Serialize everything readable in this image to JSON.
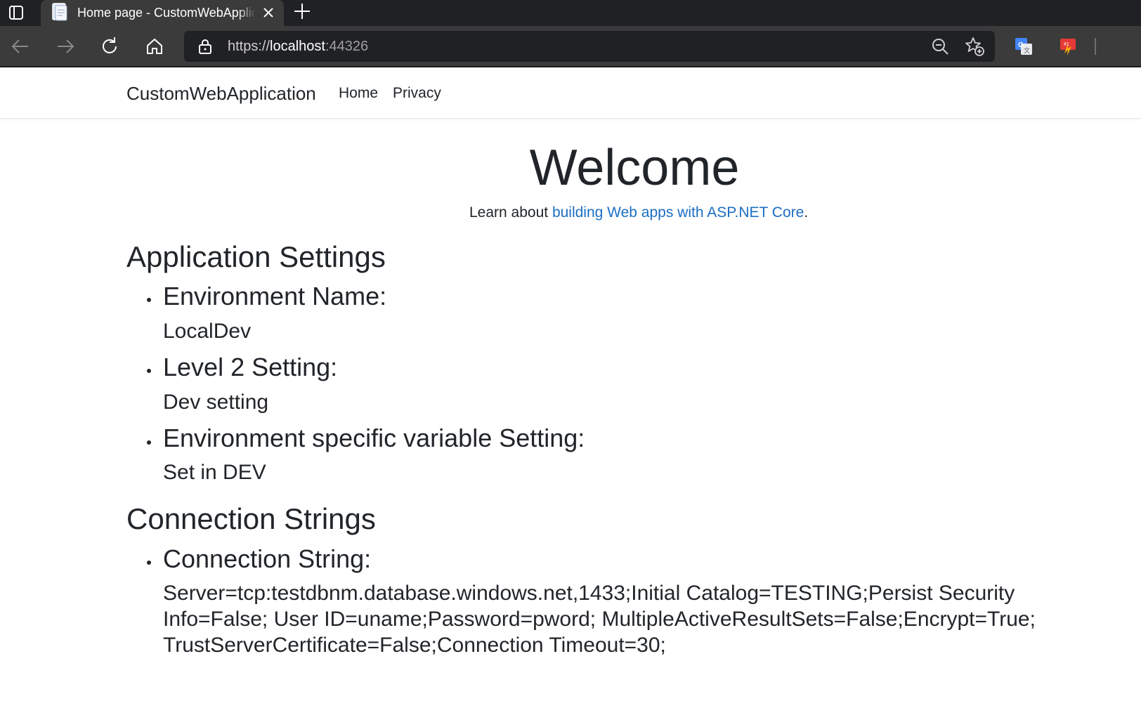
{
  "browser": {
    "tab": {
      "title": "Home page - CustomWebApplication"
    },
    "address": {
      "scheme": "https://",
      "host": "localhost",
      "port": ":44326"
    },
    "icons": {
      "tab_actions": "tab-actions-icon",
      "favicon": "page-icon",
      "close_tab": "close-icon",
      "new_tab": "plus-icon",
      "back": "back-arrow-icon",
      "forward": "forward-arrow-icon",
      "refresh": "refresh-icon",
      "home": "home-icon",
      "lock": "lock-icon",
      "zoom": "zoom-out-icon",
      "favorite": "add-favorite-icon",
      "translate": "translate-icon",
      "extension": "extension-icon"
    },
    "colors": {
      "tabstrip": "#202124",
      "toolbar": "#3b3b3b",
      "link": "#1b6ec2"
    }
  },
  "navbar": {
    "brand": "CustomWebApplication",
    "links": [
      "Home",
      "Privacy"
    ]
  },
  "main": {
    "title": "Welcome",
    "learn_prefix": "Learn about ",
    "learn_link": "building Web apps with ASP.NET Core",
    "learn_suffix": ".",
    "app_settings": {
      "heading": "Application Settings",
      "items": [
        {
          "label": "Environment Name:",
          "value": "LocalDev"
        },
        {
          "label": "Level 2 Setting:",
          "value": "Dev setting"
        },
        {
          "label": "Environment specific variable Setting:",
          "value": "Set in DEV"
        }
      ]
    },
    "connection_strings": {
      "heading": "Connection Strings",
      "items": [
        {
          "label": "Connection String:",
          "value": "Server=tcp:testdbnm.database.windows.net,1433;Initial Catalog=TESTING;Persist Security Info=False; User ID=uname;Password=pword; MultipleActiveResultSets=False;Encrypt=True; TrustServerCertificate=False;Connection Timeout=30;"
        }
      ]
    }
  }
}
